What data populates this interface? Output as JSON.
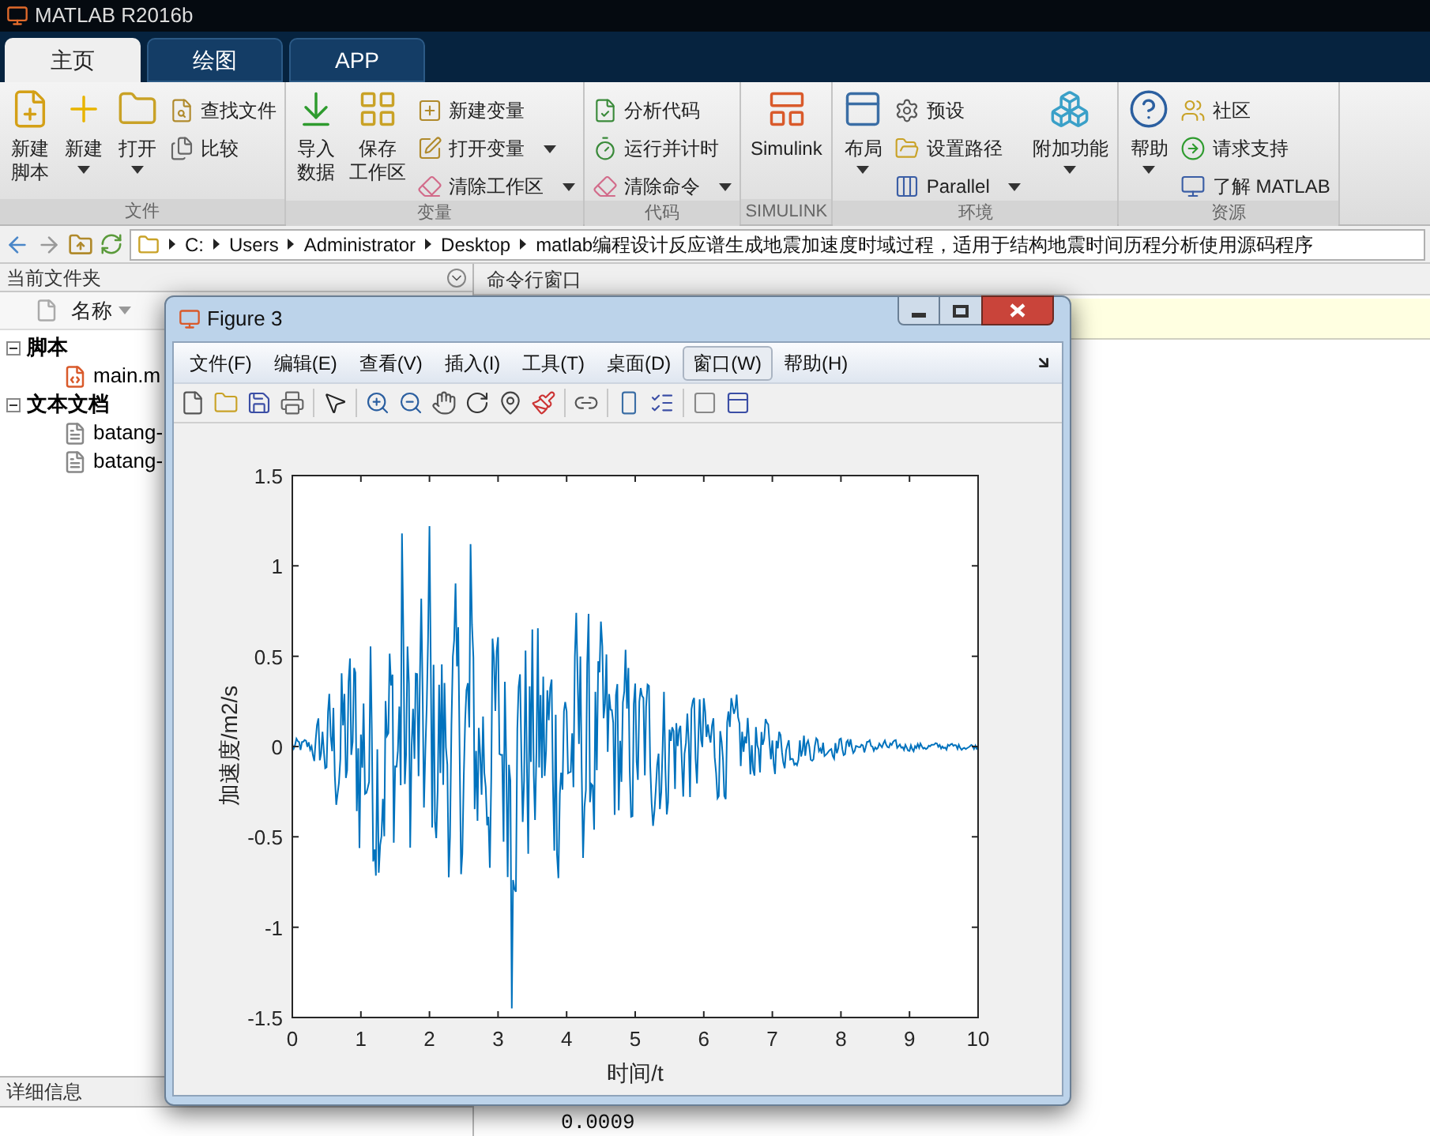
{
  "window": {
    "title": "MATLAB R2016b"
  },
  "tabs": [
    {
      "label": "主页",
      "selected": true
    },
    {
      "label": "绘图",
      "selected": false
    },
    {
      "label": "APP",
      "selected": false
    }
  ],
  "ribbon_groups": [
    {
      "label": "文件",
      "items": [
        {
          "kind": "large",
          "lines": [
            "新建",
            "脚本"
          ],
          "dropdown": false
        },
        {
          "kind": "large",
          "lines": [
            "新建"
          ],
          "dropdown": true
        },
        {
          "kind": "large",
          "lines": [
            "打开"
          ],
          "dropdown": true
        },
        {
          "kind": "stack",
          "items": [
            {
              "label": "查找文件",
              "dropdown": false
            },
            {
              "label": "比较",
              "dropdown": false
            }
          ]
        }
      ]
    },
    {
      "label": "变量",
      "items": [
        {
          "kind": "large",
          "lines": [
            "导入",
            "数据"
          ],
          "dropdown": false
        },
        {
          "kind": "large",
          "lines": [
            "保存",
            "工作区"
          ],
          "dropdown": false
        },
        {
          "kind": "stack",
          "items": [
            {
              "label": "新建变量",
              "dropdown": false
            },
            {
              "label": "打开变量",
              "dropdown": true
            },
            {
              "label": "清除工作区",
              "dropdown": true
            }
          ]
        }
      ]
    },
    {
      "label": "代码",
      "items": [
        {
          "kind": "stack",
          "items": [
            {
              "label": "分析代码",
              "dropdown": false
            },
            {
              "label": "运行并计时",
              "dropdown": false
            },
            {
              "label": "清除命令",
              "dropdown": true
            }
          ]
        }
      ]
    },
    {
      "label": "SIMULINK",
      "items": [
        {
          "kind": "large",
          "lines": [
            "Simulink"
          ],
          "dropdown": false
        }
      ]
    },
    {
      "label": "环境",
      "items": [
        {
          "kind": "large",
          "lines": [
            "布局"
          ],
          "dropdown": true
        },
        {
          "kind": "stack",
          "items": [
            {
              "label": "预设",
              "dropdown": false
            },
            {
              "label": "设置路径",
              "dropdown": false
            },
            {
              "label": "Parallel",
              "dropdown": true
            }
          ]
        },
        {
          "kind": "large",
          "lines": [
            "附加功能"
          ],
          "dropdown": true
        }
      ]
    },
    {
      "label": "资源",
      "items": [
        {
          "kind": "large",
          "lines": [
            "帮助"
          ],
          "dropdown": true
        },
        {
          "kind": "stack",
          "items": [
            {
              "label": "社区",
              "dropdown": false
            },
            {
              "label": "请求支持",
              "dropdown": false
            },
            {
              "label": "了解 MATLAB",
              "dropdown": false
            }
          ]
        }
      ]
    }
  ],
  "address_bar": {
    "segments": [
      "C:",
      "Users",
      "Administrator",
      "Desktop",
      "matlab编程设计反应谱生成地震加速度时域过程，适用于结构地震时间历程分析使用源码程序"
    ]
  },
  "current_folder": {
    "title": "当前文件夹",
    "column": "名称",
    "tree": [
      {
        "label": "脚本",
        "expanded": true,
        "children": [
          {
            "label": "main.m",
            "kind": "mfile"
          }
        ]
      },
      {
        "label": "文本文档",
        "expanded": true,
        "children": [
          {
            "label": "batang-",
            "kind": "text"
          },
          {
            "label": "batang-",
            "kind": "text"
          }
        ]
      }
    ],
    "details_title": "详细信息"
  },
  "command_window": {
    "title": "命令行窗口",
    "output": [
      "0.0009"
    ]
  },
  "figure": {
    "title": "Figure 3",
    "menus": [
      {
        "label": "文件(F)",
        "selected": false
      },
      {
        "label": "编辑(E)",
        "selected": false
      },
      {
        "label": "查看(V)",
        "selected": false
      },
      {
        "label": "插入(I)",
        "selected": false
      },
      {
        "label": "工具(T)",
        "selected": false
      },
      {
        "label": "桌面(D)",
        "selected": false
      },
      {
        "label": "窗口(W)",
        "selected": true
      },
      {
        "label": "帮助(H)",
        "selected": false
      }
    ],
    "axes": {
      "xlabel": "时间/t",
      "ylabel": "加速度/m2/s",
      "xticks": [
        "0",
        "1",
        "2",
        "3",
        "4",
        "5",
        "6",
        "7",
        "8",
        "9",
        "10"
      ],
      "yticks": [
        "1.5",
        "1",
        "0.5",
        "0",
        "-0.5",
        "-1",
        "-1.5"
      ]
    }
  }
}
